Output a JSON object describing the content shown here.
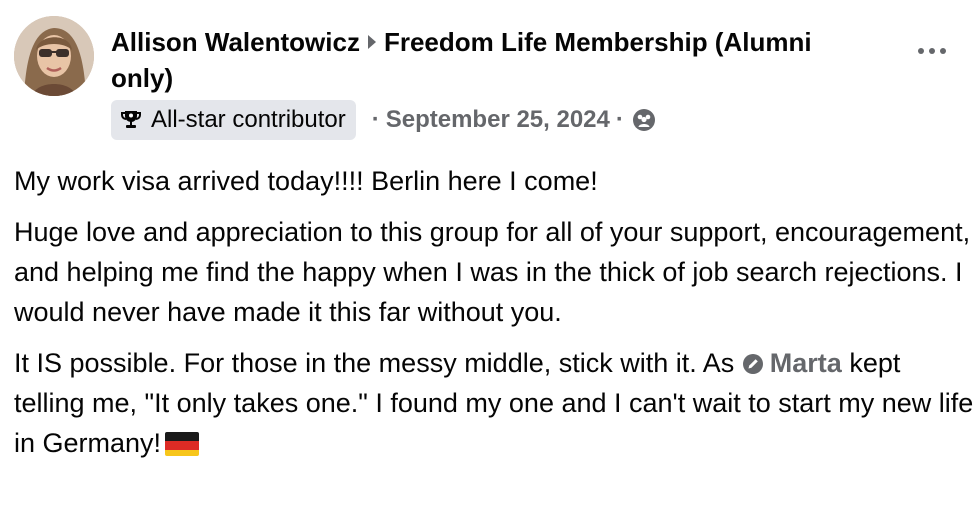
{
  "post": {
    "author": "Allison Walentowicz",
    "group": "Freedom Life Membership (Alumni only)",
    "badge_label": "All-star contributor",
    "date": "September 25, 2024",
    "meta_separator": "·",
    "audience_icon": "members-icon",
    "more_icon": "more-options-icon",
    "paragraphs": {
      "p1": "My work visa arrived today!!!! Berlin here I come!",
      "p2": "Huge love and appreciation to this group for all of your support, encouragement, and helping me find the happy when I was in the thick of job search rejections. I would never have made it this far without you.",
      "p3_before": "It IS possible. For those in the messy middle, stick with it. As",
      "mention": "Marta",
      "p3_after": "kept telling me, \"It only takes one.\" I found my one and I can't wait to start my new life in Germany!"
    },
    "flag_emoji": "germany-flag",
    "colors": {
      "text": "#050505",
      "secondary": "#65676b",
      "badge_bg": "#e4e6eb"
    }
  }
}
